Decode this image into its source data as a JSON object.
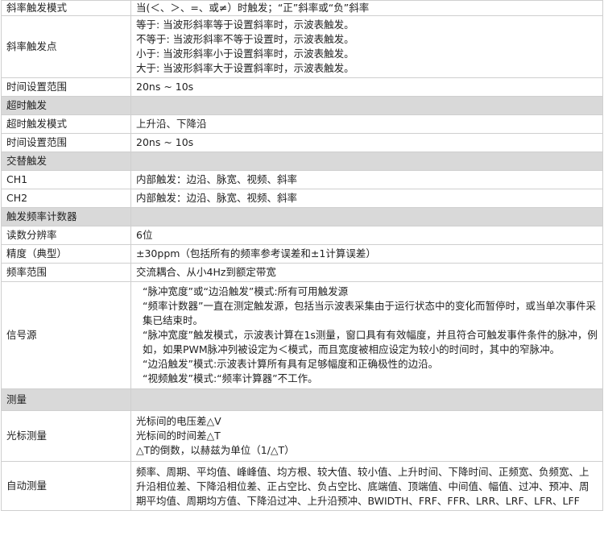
{
  "trigger_rows": [
    {
      "label": "斜率触发模式",
      "lines": [
        "当(＜、＞、=、或≠）时触发；“正”斜率或“负”斜率"
      ]
    },
    {
      "label": "斜率触发点",
      "lines": [
        "等于: 当波形斜率等于设置斜率时，示波表触发。",
        "不等于: 当波形斜率不等于设置时，示波表触发。",
        "小于: 当波形斜率小于设置斜率时，示波表触发。",
        "大于: 当波形斜率大于设置斜率时，示波表触发。"
      ]
    },
    {
      "label": "时间设置范围",
      "lines": [
        "20ns ~ 10s"
      ]
    }
  ],
  "timeout": {
    "title": "超时触发",
    "rows": [
      {
        "label": "超时触发模式",
        "value": "上升沿、下降沿"
      },
      {
        "label": "时间设置范围",
        "value": "20ns ~ 10s"
      }
    ]
  },
  "alternate": {
    "title": "交替触发",
    "rows": [
      {
        "label": "CH1",
        "value": "内部触发：边沿、脉宽、视频、斜率"
      },
      {
        "label": "CH2",
        "value": "内部触发：边沿、脉宽、视频、斜率"
      }
    ]
  },
  "counter": {
    "title": "触发频率计数器",
    "rows": [
      {
        "label": "读数分辨率",
        "value": "6位"
      },
      {
        "label": "精度（典型）",
        "value": "±30ppm（包括所有的频率参考误差和±1计算误差）"
      },
      {
        "label": "频率范围",
        "value": "交流耦合、从小4Hz到额定带宽"
      }
    ],
    "source_label": "信号源",
    "source_paras": [
      "“脉冲宽度”或“边沿触发”模式:所有可用触发源",
      "“频率计数器”一直在测定触发源，包括当示波表采集由于运行状态中的变化而暂停时，或当单次事件采集已结束时。",
      "“脉冲宽度”触发模式，示波表计算在1s测量，窗口具有有效幅度，并且符合可触发事件条件的脉冲，例如，如果PWM脉冲列被设定为＜模式，而且宽度被相应设定为较小的时间时，其中的窄脉冲。",
      "“边沿触发”模式:示波表计算所有具有足够幅度和正确极性的边沿。",
      "“视频触发”模式:“频率计算器”不工作。"
    ]
  },
  "measure": {
    "title": "测量",
    "cursor_label": "光标测量",
    "cursor_lines": [
      "光标间的电压差△V",
      "光标间的时间差△T",
      "△T的倒数，以赫兹为单位（1/△T）"
    ],
    "auto_label": "自动测量",
    "auto_value": "频率、周期、平均值、峰峰值、均方根、较大值、较小值、上升时间、下降时间、正频宽、负频宽、上升沿相位差、下降沿相位差、正占空比、负占空比、底端值、顶端值、中间值、幅值、过冲、预冲、周期平均值、周期均方值、下降沿过冲、上升沿预冲、BWIDTH、FRF、FFR、LRR、LRF、LFR、LFF"
  }
}
